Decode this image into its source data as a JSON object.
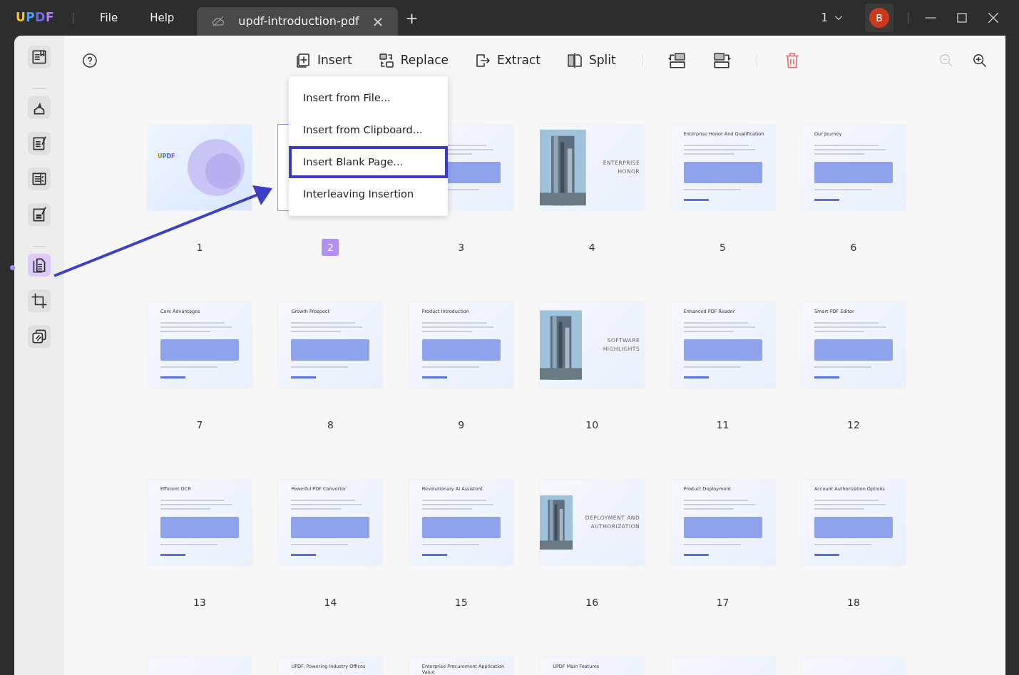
{
  "titlebar": {
    "logo": "UPDF",
    "menus": [
      "File",
      "Help"
    ],
    "tab": {
      "title": "updf-introduction-pdf",
      "close": "×"
    },
    "new_tab": "+",
    "page_count": "1",
    "avatar": "B"
  },
  "sidebar": [
    {
      "kind": "reader",
      "selected": false
    },
    {
      "kind": "divider"
    },
    {
      "kind": "comment",
      "selected": false
    },
    {
      "kind": "edit",
      "selected": false
    },
    {
      "kind": "form",
      "selected": false
    },
    {
      "kind": "fill",
      "selected": false
    },
    {
      "kind": "divider"
    },
    {
      "kind": "organize",
      "selected": true
    },
    {
      "kind": "crop",
      "selected": false
    },
    {
      "kind": "layers",
      "selected": false
    }
  ],
  "toolbar": {
    "tools": [
      {
        "kind": "insert",
        "label": "Insert"
      },
      {
        "kind": "replace",
        "label": "Replace"
      },
      {
        "kind": "extract",
        "label": "Extract"
      },
      {
        "kind": "split",
        "label": "Split"
      },
      {
        "kind": "sep"
      },
      {
        "kind": "rotate_left"
      },
      {
        "kind": "rotate_right"
      },
      {
        "kind": "sep"
      },
      {
        "kind": "delete"
      }
    ],
    "zoom_out_disabled": true
  },
  "insert_menu": [
    {
      "label": "Insert from File...",
      "highlighted": false
    },
    {
      "label": "Insert from Clipboard...",
      "highlighted": false
    },
    {
      "label": "Insert Blank Page...",
      "highlighted": true
    },
    {
      "label": "Interleaving Insertion",
      "highlighted": false
    }
  ],
  "pages": [
    {
      "number": "1",
      "kind": "cover",
      "title": "UPDF",
      "selected": false
    },
    {
      "number": "2",
      "kind": "blank",
      "selected": true
    },
    {
      "number": "3",
      "kind": "text",
      "selected": false
    },
    {
      "number": "4",
      "title": "ENTERPRISE HONOR",
      "selected": false
    },
    {
      "number": "5",
      "kind": "text",
      "title": "Enterprise Honor And Qualification",
      "selected": false
    },
    {
      "number": "6",
      "kind": "text",
      "title": "Our Journey",
      "selected": false
    },
    {
      "number": "7",
      "kind": "text",
      "title": "Core Advantages",
      "selected": false
    },
    {
      "number": "8",
      "kind": "text",
      "title": "Growth Prospect",
      "selected": false
    },
    {
      "number": "9",
      "kind": "text",
      "title": "Product Introduction",
      "selected": false
    },
    {
      "number": "10",
      "title": "SOFTWARE HIGHLIGHTS",
      "selected": false
    },
    {
      "number": "11",
      "kind": "text",
      "title": "Enhanced PDF Reader",
      "selected": false
    },
    {
      "number": "12",
      "kind": "text",
      "title": "Smart PDF Editor",
      "selected": false
    },
    {
      "number": "13",
      "kind": "text",
      "title": "Efficient OCR",
      "selected": false
    },
    {
      "number": "14",
      "kind": "text",
      "title": "Powerful PDF Converter",
      "selected": false
    },
    {
      "number": "15",
      "kind": "text",
      "title": "Revolutionary AI Assistent",
      "selected": false
    },
    {
      "number": "16",
      "title": "DEPLOYMENT AND AUTHORIZATION",
      "selected": false
    },
    {
      "number": "17",
      "kind": "text",
      "title": "Product Deployment",
      "selected": false
    },
    {
      "number": "18",
      "kind": "text",
      "title": "Account Authorization Options",
      "selected": false
    },
    {
      "kind": "partial",
      "selected": false
    },
    {
      "kind": "partial",
      "title": "UPDF: Powering Industry Offices",
      "selected": false
    },
    {
      "kind": "partial",
      "title": "Enterprise Procurement Application Value",
      "selected": false
    },
    {
      "kind": "partial",
      "title": "UPDF Main Features",
      "selected": false
    },
    {
      "kind": "partial",
      "selected": false
    },
    {
      "kind": "partial",
      "selected": false
    }
  ]
}
